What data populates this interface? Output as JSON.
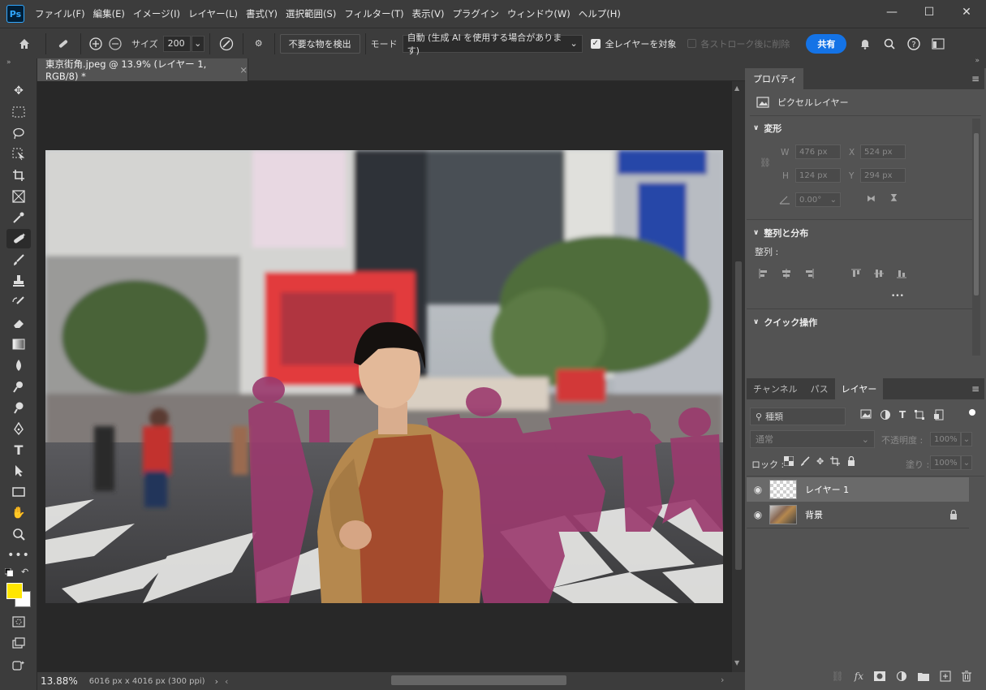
{
  "menubar": {
    "logo": "Ps",
    "items": [
      "ファイル(F)",
      "編集(E)",
      "イメージ(I)",
      "レイヤー(L)",
      "書式(Y)",
      "選択範囲(S)",
      "フィルター(T)",
      "表示(V)",
      "プラグイン",
      "ウィンドウ(W)",
      "ヘルプ(H)"
    ],
    "minimize": "—",
    "maximize": "☐",
    "close": "✕"
  },
  "options": {
    "size_label": "サイズ",
    "size_value": "200",
    "detect_button": "不要な物を検出",
    "mode_label": "モード",
    "mode_value": "自動 (生成 AI を使用する場合があります)",
    "all_layers_label": "全レイヤーを対象",
    "after_stroke_label": "各ストローク後に削除",
    "share_button": "共有"
  },
  "document": {
    "tab_title": "東京街角.jpeg @ 13.9% (レイヤー 1, RGB/8) *",
    "tab_close": "×",
    "zoom": "13.88%",
    "doc_info": "6016 px x 4016 px (300 ppi)"
  },
  "properties": {
    "tab": "プロパティ",
    "layer_type": "ピクセルレイヤー",
    "transform_header": "変形",
    "w_label": "W",
    "w_value": "476 px",
    "h_label": "H",
    "h_value": "124 px",
    "x_label": "X",
    "x_value": "524 px",
    "y_label": "Y",
    "y_value": "294 px",
    "angle_value": "0.00°",
    "align_header": "整列と分布",
    "align_label": "整列 :",
    "more": "•••",
    "quick_header": "クイック操作"
  },
  "layers_panel": {
    "tabs": [
      "チャンネル",
      "パス",
      "レイヤー"
    ],
    "filter_placeholder": "種類",
    "blend_mode": "通常",
    "opacity_label": "不透明度 :",
    "opacity_value": "100%",
    "lock_label": "ロック :",
    "fill_label": "塗り :",
    "fill_value": "100%",
    "layers": [
      {
        "name": "レイヤー 1"
      },
      {
        "name": "背景"
      }
    ]
  },
  "colors": {
    "foreground": "#ffe600",
    "background": "#ffffff",
    "accent": "#1473e6",
    "mask": "#9b3a6e"
  }
}
